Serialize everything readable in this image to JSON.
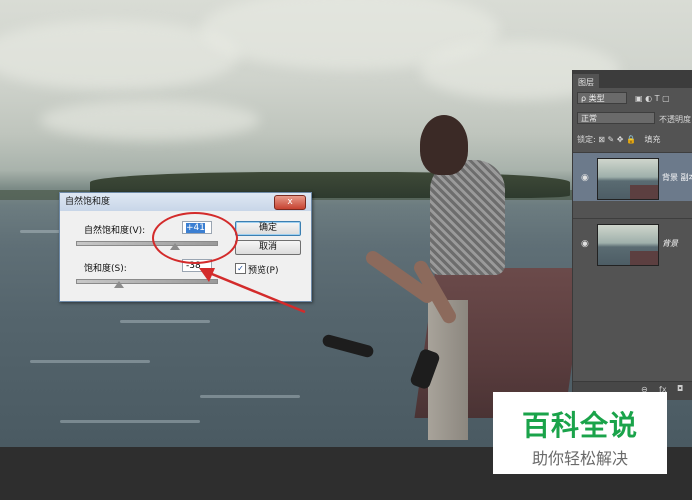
{
  "dialog": {
    "title": "自然饱和度",
    "close_label": "x",
    "vibrance_label": "自然饱和度(V):",
    "vibrance_value": "+41",
    "vibrance_level": 0.705,
    "saturation_label": "饱和度(S):",
    "saturation_value": "-38",
    "saturation_level": 0.31,
    "ok_label": "确定",
    "cancel_label": "取消",
    "preview_label": "预览(P)",
    "preview_checked": true,
    "check_mark": "✓"
  },
  "layers_panel": {
    "tab_label": "图层",
    "filter_label": "ρ 类型",
    "blend_mode": "正常",
    "opacity_label": "不透明度",
    "lock_label": "锁定:",
    "fill_label": "填充",
    "layers": [
      {
        "name": "背景 副本",
        "active": true
      },
      {
        "name": "背景",
        "active": false
      }
    ],
    "footer_icon": "fx"
  },
  "watermark": {
    "title": "百科全说",
    "subtitle": "助你轻松解决"
  },
  "colors": {
    "accent_red": "#d32b2b",
    "watermark_green": "#1aa34a"
  }
}
